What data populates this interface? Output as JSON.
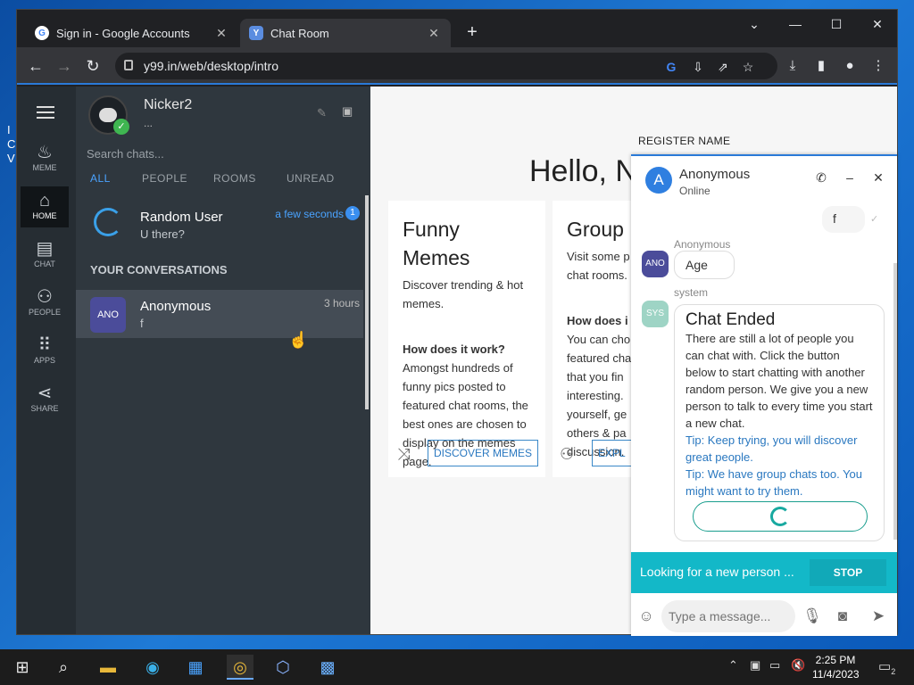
{
  "desktop": {
    "side_text": "I\nC\nV"
  },
  "browser": {
    "tabs": [
      {
        "label": "Sign in - Google Accounts",
        "icon": "google-icon"
      },
      {
        "label": "Chat Room",
        "icon": "y99-icon"
      }
    ],
    "url": "y99.in/web/desktop/intro"
  },
  "rail": {
    "items": [
      {
        "label": "MEME"
      },
      {
        "label": "HOME"
      },
      {
        "label": "CHAT"
      },
      {
        "label": "PEOPLE"
      },
      {
        "label": "APPS"
      },
      {
        "label": "SHARE"
      }
    ]
  },
  "sidebar": {
    "username": "Nicker2",
    "status": "...",
    "search_placeholder": "Search chats...",
    "filters": [
      "ALL",
      "PEOPLE",
      "ROOMS",
      "UNREAD"
    ],
    "random": {
      "name": "Random User",
      "message": "U there?",
      "time": "a few seconds",
      "badge": "1"
    },
    "section": "YOUR CONVERSATIONS",
    "conversation": {
      "avatar": "ANO",
      "name": "Anonymous",
      "message": "f",
      "time": "3 hours"
    }
  },
  "main": {
    "hello": "Hello, N",
    "register": "REGISTER NAME",
    "card1": {
      "title": "Funny Memes",
      "desc": "Discover trending & hot memes.",
      "how": "How does it work?",
      "body": "Amongst hundreds of funny pics posted to featured chat rooms, the best ones are chosen to display on the memes page.",
      "button": "DISCOVER MEMES"
    },
    "card2": {
      "title": "Group Rooms",
      "desc": "Visit some p chat rooms.",
      "how": "How does i",
      "body": "You can cho featured cha that you fin interesting. yourself, ge others & pa discussion.",
      "button": "EXPL"
    }
  },
  "chat": {
    "avatar": "A",
    "name": "Anonymous",
    "status": "Online",
    "my_msg": "f",
    "their_name": "Anonymous",
    "their_avatar": "ANO",
    "their_msg": "Age",
    "system_name": "system",
    "system_avatar": "SYS",
    "ended_title": "Chat Ended",
    "ended_body": "There are still a lot of people you can chat with. Click the button below to start chatting with another random person. We give you a new person to talk to every time you start a new chat.",
    "tip1": "Tip: Keep trying, you will discover great people.",
    "tip2": "Tip: We have group chats too. You might want to try them.",
    "looking": "Looking for a new person ...",
    "stop": "STOP",
    "placeholder": "Type a message..."
  },
  "taskbar": {
    "time": "2:25 PM",
    "date": "11/4/2023",
    "notif": "2"
  }
}
